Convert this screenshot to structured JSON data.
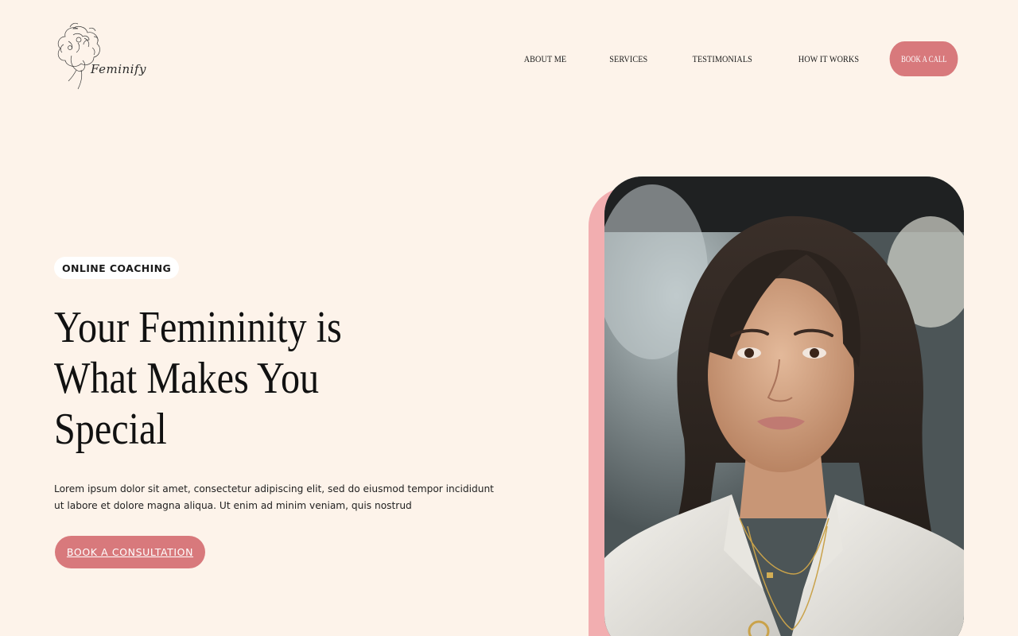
{
  "brand": {
    "name": "Feminify"
  },
  "nav": {
    "items": [
      {
        "label": "ABOUT ME"
      },
      {
        "label": "SERVICES"
      },
      {
        "label": "TESTIMONIALS"
      },
      {
        "label": "HOW IT WORKS"
      }
    ],
    "cta_label": "BOOK A CALL"
  },
  "hero": {
    "badge": "ONLINE COACHING",
    "headline_line1": "Your Femininity is",
    "headline_line2": "What Makes You",
    "headline_line3": "Special",
    "body": "Lorem ipsum dolor sit amet, consectetur adipiscing elit, sed do eiusmod tempor incididunt ut labore et dolore magna aliqua. Ut enim ad minim veniam, quis nostrud",
    "button_label": "BOOK A CONSULTATION"
  },
  "colors": {
    "background": "#fdf3ea",
    "accent": "#d8797c",
    "photo_backing": "#f2aeb0"
  },
  "icons": {
    "logo": "floral-woman-line-art-icon"
  }
}
